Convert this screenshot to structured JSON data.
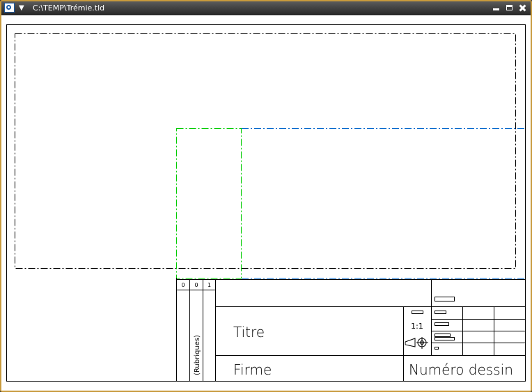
{
  "window": {
    "title": "C:\\TEMP\\Trémie.tld",
    "accent_border": "#c89a3c",
    "icon": "app-icon",
    "menu_icon": "dropdown-arrow-icon",
    "controls": [
      "minimize-icon",
      "maximize-icon",
      "close-icon"
    ]
  },
  "drawing": {
    "background": "#ffffff",
    "line_colors": {
      "frame": "#000000",
      "view_green": "#00cc00",
      "view_blue": "#0066cc"
    },
    "title_block": {
      "revision_cells": [
        "0",
        "0",
        "1"
      ],
      "rubriques_label": "(Rubriques)",
      "title_label": "Titre",
      "firm_label": "Firme",
      "drawing_number_label": "Numéro dessin",
      "scale": "1:1",
      "projection_icon": "first-angle-projection-icon"
    }
  }
}
